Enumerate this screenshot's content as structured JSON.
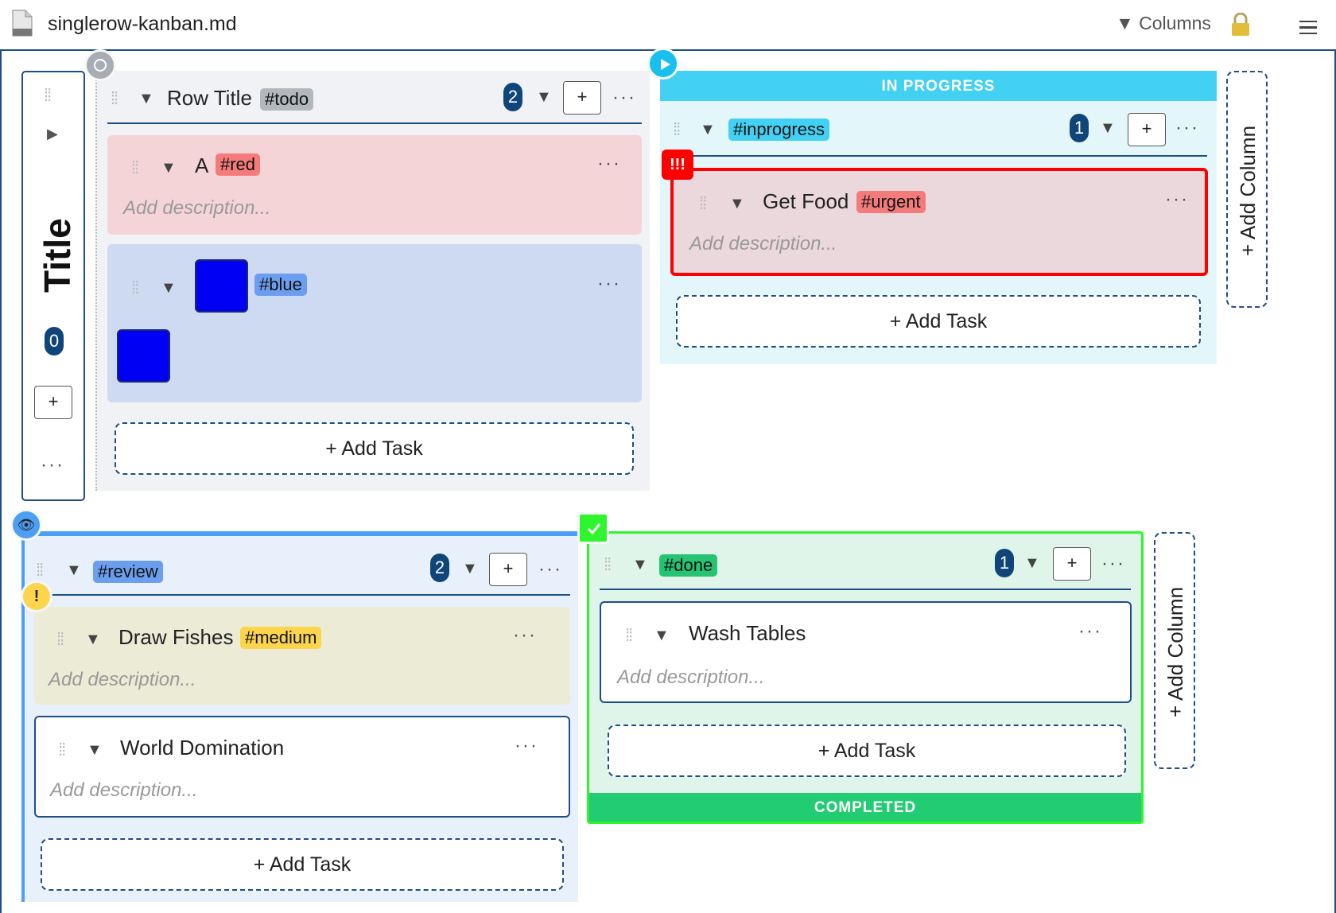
{
  "window": {
    "file_name": "singlerow-kanban.md",
    "columns_menu": "▼ Columns"
  },
  "row": {
    "title": "Title",
    "count": "0",
    "add": "+"
  },
  "columns": {
    "todo": {
      "title": "Row Title",
      "tag": "#todo",
      "count": "2",
      "add": "+",
      "cards": [
        {
          "title": "A",
          "tag": "#red",
          "desc": "Add description..."
        },
        {
          "title": "",
          "tag": "#blue",
          "desc": ""
        }
      ],
      "add_task": "+ Add Task"
    },
    "inprogress": {
      "header": "IN PROGRESS",
      "tag": "#inprogress",
      "count": "1",
      "add": "+",
      "priority_badge": "!!!",
      "cards": [
        {
          "title": "Get Food",
          "tag": "#urgent",
          "desc": "Add description..."
        }
      ],
      "add_task": "+ Add Task"
    },
    "review": {
      "tag": "#review",
      "count": "2",
      "add": "+",
      "priority_badge": "!",
      "cards": [
        {
          "title": "Draw Fishes",
          "tag": "#medium",
          "desc": "Add description..."
        },
        {
          "title": "World Domination",
          "tag": "",
          "desc": "Add description..."
        }
      ],
      "add_task": "+ Add Task"
    },
    "done": {
      "tag": "#done",
      "count": "1",
      "add": "+",
      "footer": "COMPLETED",
      "cards": [
        {
          "title": "Wash Tables",
          "desc": "Add description..."
        }
      ],
      "add_task": "+ Add Task"
    }
  },
  "add_column": "+ Add Column",
  "colors": {
    "accent": "#1c4e8a",
    "red_card": "#f5d4d7",
    "blue_card": "#cddaf2",
    "inprogress": "#42d1f2",
    "done_border": "#2ef52e",
    "completed": "#22cc72",
    "review_border": "#4d9ff5"
  }
}
